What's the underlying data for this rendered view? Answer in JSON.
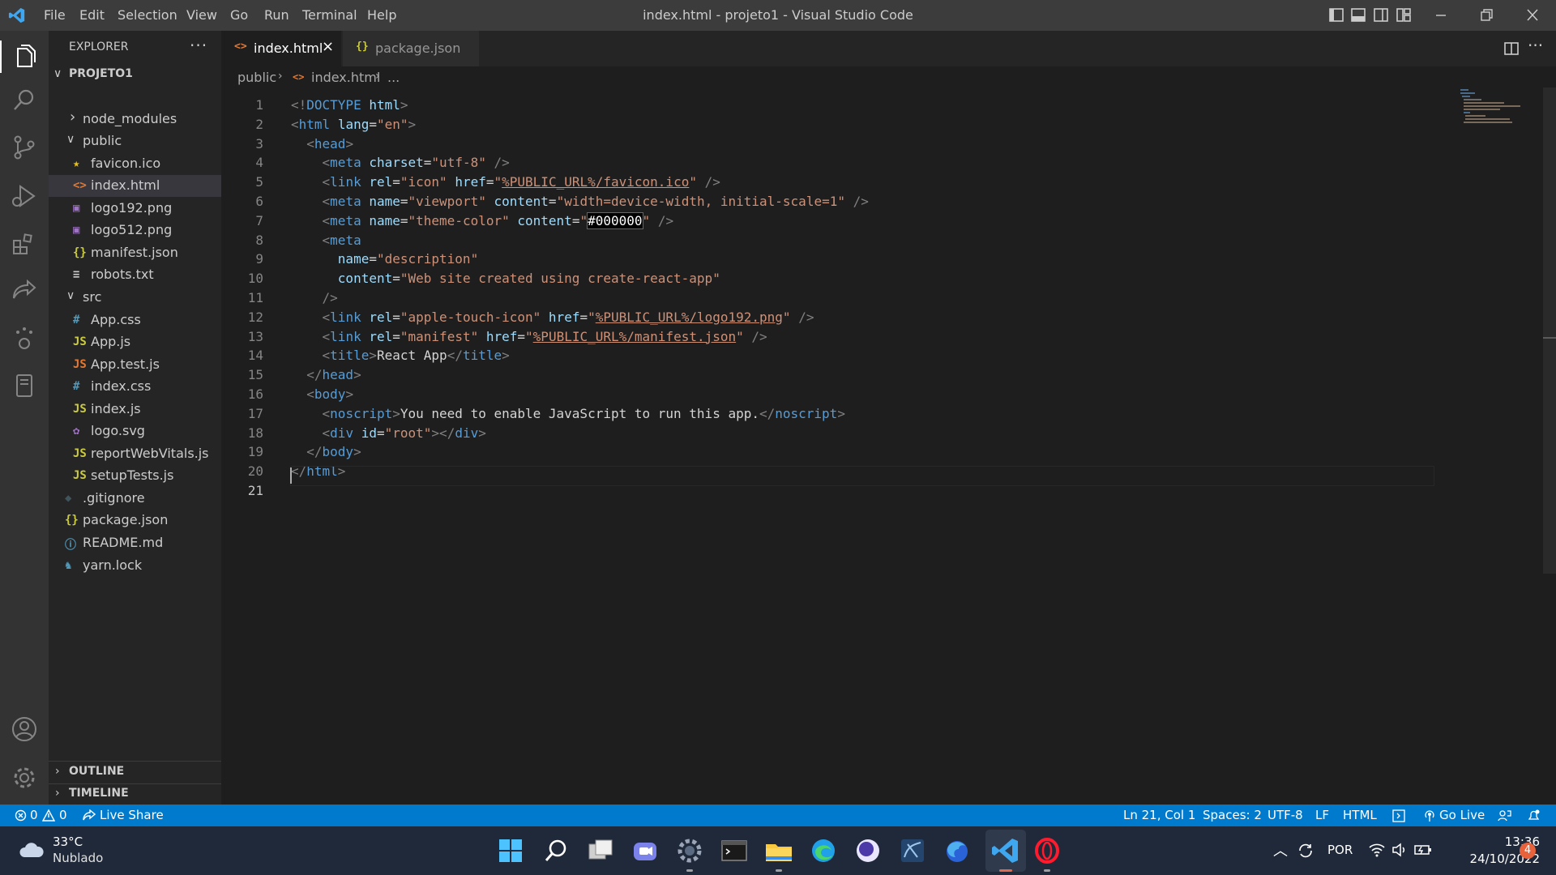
{
  "titlebar": {
    "menu": [
      "File",
      "Edit",
      "Selection",
      "View",
      "Go",
      "Run",
      "Terminal",
      "Help"
    ],
    "title": "index.html - projeto1 - Visual Studio Code"
  },
  "sidebar": {
    "header": "EXPLORER",
    "project": "PROJETO1",
    "tree": [
      {
        "name": "node_modules",
        "kind": "folder-closed",
        "icon": "chevron-right-icon"
      },
      {
        "name": "public",
        "kind": "folder-open",
        "icon": "chevron-down-icon"
      },
      {
        "name": "favicon.ico",
        "kind": "file",
        "icon": "star-icon",
        "glyph": "★",
        "color": "#e8c020"
      },
      {
        "name": "index.html",
        "kind": "file",
        "icon": "html-icon",
        "glyph": "<>",
        "color": "#e37933"
      },
      {
        "name": "logo192.png",
        "kind": "file",
        "icon": "image-icon",
        "glyph": "▣",
        "color": "#a074c4"
      },
      {
        "name": "logo512.png",
        "kind": "file",
        "icon": "image-icon",
        "glyph": "▣",
        "color": "#a074c4"
      },
      {
        "name": "manifest.json",
        "kind": "file",
        "icon": "json-icon",
        "glyph": "{}",
        "color": "#cbcb41"
      },
      {
        "name": "robots.txt",
        "kind": "file",
        "icon": "text-file-icon",
        "glyph": "≡",
        "color": "#cccccc"
      },
      {
        "name": "src",
        "kind": "folder-open",
        "icon": "chevron-down-icon"
      },
      {
        "name": "App.css",
        "kind": "file",
        "icon": "css-icon",
        "glyph": "#",
        "color": "#519aba"
      },
      {
        "name": "App.js",
        "kind": "file",
        "icon": "js-icon",
        "glyph": "JS",
        "color": "#cbcb41"
      },
      {
        "name": "App.test.js",
        "kind": "file",
        "icon": "js-test-icon",
        "glyph": "JS",
        "color": "#e37933"
      },
      {
        "name": "index.css",
        "kind": "file",
        "icon": "css-icon",
        "glyph": "#",
        "color": "#519aba"
      },
      {
        "name": "index.js",
        "kind": "file",
        "icon": "js-icon",
        "glyph": "JS",
        "color": "#cbcb41"
      },
      {
        "name": "logo.svg",
        "kind": "file",
        "icon": "svg-icon",
        "glyph": "✿",
        "color": "#a074c4"
      },
      {
        "name": "reportWebVitals.js",
        "kind": "file",
        "icon": "js-icon",
        "glyph": "JS",
        "color": "#cbcb41"
      },
      {
        "name": "setupTests.js",
        "kind": "file",
        "icon": "js-icon",
        "glyph": "JS",
        "color": "#cbcb41"
      },
      {
        "name": ".gitignore",
        "kind": "file",
        "icon": "git-icon",
        "glyph": "◆",
        "color": "#41535b"
      },
      {
        "name": "package.json",
        "kind": "file",
        "icon": "json-icon",
        "glyph": "{}",
        "color": "#cbcb41"
      },
      {
        "name": "README.md",
        "kind": "file",
        "icon": "info-icon",
        "glyph": "ⓘ",
        "color": "#519aba"
      },
      {
        "name": "yarn.lock",
        "kind": "file",
        "icon": "yarn-icon",
        "glyph": "♞",
        "color": "#519aba"
      }
    ],
    "outline": "OUTLINE",
    "timeline": "TIMELINE"
  },
  "tabs": [
    {
      "label": "index.html",
      "glyph": "<>",
      "color": "#e37933",
      "active": true
    },
    {
      "label": "package.json",
      "glyph": "{}",
      "color": "#cbcb41",
      "active": false
    }
  ],
  "breadcrumb": [
    "public",
    "index.html",
    "..."
  ],
  "code_lines": [
    [
      [
        "pn",
        "<!"
      ],
      [
        "tg",
        "DOCTYPE"
      ],
      [
        "tx",
        " "
      ],
      [
        "at",
        "html"
      ],
      [
        "pn",
        ">"
      ]
    ],
    [
      [
        "pn",
        "<"
      ],
      [
        "tg",
        "html"
      ],
      [
        "tx",
        " "
      ],
      [
        "at",
        "lang"
      ],
      [
        "tx",
        "="
      ],
      [
        "st",
        "\"en\""
      ],
      [
        "pn",
        ">"
      ]
    ],
    [
      [
        "tx",
        "  "
      ],
      [
        "pn",
        "<"
      ],
      [
        "tg",
        "head"
      ],
      [
        "pn",
        ">"
      ]
    ],
    [
      [
        "tx",
        "    "
      ],
      [
        "pn",
        "<"
      ],
      [
        "tg",
        "meta"
      ],
      [
        "tx",
        " "
      ],
      [
        "at",
        "charset"
      ],
      [
        "tx",
        "="
      ],
      [
        "st",
        "\"utf-8\""
      ],
      [
        "tx",
        " "
      ],
      [
        "pn",
        "/>"
      ]
    ],
    [
      [
        "tx",
        "    "
      ],
      [
        "pn",
        "<"
      ],
      [
        "tg",
        "link"
      ],
      [
        "tx",
        " "
      ],
      [
        "at",
        "rel"
      ],
      [
        "tx",
        "="
      ],
      [
        "st",
        "\"icon\""
      ],
      [
        "tx",
        " "
      ],
      [
        "at",
        "href"
      ],
      [
        "tx",
        "="
      ],
      [
        "st",
        "\""
      ],
      [
        "st ul",
        "%PUBLIC_URL%/favicon.ico"
      ],
      [
        "st",
        "\""
      ],
      [
        "tx",
        " "
      ],
      [
        "pn",
        "/>"
      ]
    ],
    [
      [
        "tx",
        "    "
      ],
      [
        "pn",
        "<"
      ],
      [
        "tg",
        "meta"
      ],
      [
        "tx",
        " "
      ],
      [
        "at",
        "name"
      ],
      [
        "tx",
        "="
      ],
      [
        "st",
        "\"viewport\""
      ],
      [
        "tx",
        " "
      ],
      [
        "at",
        "content"
      ],
      [
        "tx",
        "="
      ],
      [
        "st",
        "\"width=device-width, initial-scale=1\""
      ],
      [
        "tx",
        " "
      ],
      [
        "pn",
        "/>"
      ]
    ],
    [
      [
        "tx",
        "    "
      ],
      [
        "pn",
        "<"
      ],
      [
        "tg",
        "meta"
      ],
      [
        "tx",
        " "
      ],
      [
        "at",
        "name"
      ],
      [
        "tx",
        "="
      ],
      [
        "st",
        "\"theme-color\""
      ],
      [
        "tx",
        " "
      ],
      [
        "at",
        "content"
      ],
      [
        "tx",
        "="
      ],
      [
        "st",
        "\""
      ],
      [
        "sw",
        "#000000"
      ],
      [
        "st",
        "\""
      ],
      [
        "tx",
        " "
      ],
      [
        "pn",
        "/>"
      ]
    ],
    [
      [
        "tx",
        "    "
      ],
      [
        "pn",
        "<"
      ],
      [
        "tg",
        "meta"
      ]
    ],
    [
      [
        "tx",
        "      "
      ],
      [
        "at",
        "name"
      ],
      [
        "tx",
        "="
      ],
      [
        "st",
        "\"description\""
      ]
    ],
    [
      [
        "tx",
        "      "
      ],
      [
        "at",
        "content"
      ],
      [
        "tx",
        "="
      ],
      [
        "st",
        "\"Web site created using create-react-app\""
      ]
    ],
    [
      [
        "tx",
        "    "
      ],
      [
        "pn",
        "/>"
      ]
    ],
    [
      [
        "tx",
        "    "
      ],
      [
        "pn",
        "<"
      ],
      [
        "tg",
        "link"
      ],
      [
        "tx",
        " "
      ],
      [
        "at",
        "rel"
      ],
      [
        "tx",
        "="
      ],
      [
        "st",
        "\"apple-touch-icon\""
      ],
      [
        "tx",
        " "
      ],
      [
        "at",
        "href"
      ],
      [
        "tx",
        "="
      ],
      [
        "st",
        "\""
      ],
      [
        "st ul",
        "%PUBLIC_URL%/logo192.png"
      ],
      [
        "st",
        "\""
      ],
      [
        "tx",
        " "
      ],
      [
        "pn",
        "/>"
      ]
    ],
    [
      [
        "tx",
        "    "
      ],
      [
        "pn",
        "<"
      ],
      [
        "tg",
        "link"
      ],
      [
        "tx",
        " "
      ],
      [
        "at",
        "rel"
      ],
      [
        "tx",
        "="
      ],
      [
        "st",
        "\"manifest\""
      ],
      [
        "tx",
        " "
      ],
      [
        "at",
        "href"
      ],
      [
        "tx",
        "="
      ],
      [
        "st",
        "\""
      ],
      [
        "st ul",
        "%PUBLIC_URL%/manifest.json"
      ],
      [
        "st",
        "\""
      ],
      [
        "tx",
        " "
      ],
      [
        "pn",
        "/>"
      ]
    ],
    [
      [
        "tx",
        "    "
      ],
      [
        "pn",
        "<"
      ],
      [
        "tg",
        "title"
      ],
      [
        "pn",
        ">"
      ],
      [
        "tx",
        "React App"
      ],
      [
        "pn",
        "</"
      ],
      [
        "tg",
        "title"
      ],
      [
        "pn",
        ">"
      ]
    ],
    [
      [
        "tx",
        "  "
      ],
      [
        "pn",
        "</"
      ],
      [
        "tg",
        "head"
      ],
      [
        "pn",
        ">"
      ]
    ],
    [
      [
        "tx",
        "  "
      ],
      [
        "pn",
        "<"
      ],
      [
        "tg",
        "body"
      ],
      [
        "pn",
        ">"
      ]
    ],
    [
      [
        "tx",
        "    "
      ],
      [
        "pn",
        "<"
      ],
      [
        "tg",
        "noscript"
      ],
      [
        "pn",
        ">"
      ],
      [
        "tx",
        "You need to enable JavaScript to run this app."
      ],
      [
        "pn",
        "</"
      ],
      [
        "tg",
        "noscript"
      ],
      [
        "pn",
        ">"
      ]
    ],
    [
      [
        "tx",
        "    "
      ],
      [
        "pn",
        "<"
      ],
      [
        "tg",
        "div"
      ],
      [
        "tx",
        " "
      ],
      [
        "at",
        "id"
      ],
      [
        "tx",
        "="
      ],
      [
        "st",
        "\"root\""
      ],
      [
        "pn",
        "></"
      ],
      [
        "tg",
        "div"
      ],
      [
        "pn",
        ">"
      ]
    ],
    [
      [
        "tx",
        "  "
      ],
      [
        "pn",
        "</"
      ],
      [
        "tg",
        "body"
      ],
      [
        "pn",
        ">"
      ]
    ],
    [
      [
        "pn",
        "</"
      ],
      [
        "tg",
        "html"
      ],
      [
        "pn",
        ">"
      ]
    ],
    []
  ],
  "status": {
    "errors": "0",
    "warnings": "0",
    "live_share": "Live Share",
    "position": "Ln 21, Col 1",
    "spaces": "Spaces: 2",
    "encoding": "UTF-8",
    "eol": "LF",
    "language": "HTML",
    "go_live": "Go Live"
  },
  "taskbar": {
    "temperature": "33°C",
    "weather": "Nublado",
    "language": "POR",
    "time": "13:36",
    "date": "24/10/2022",
    "notifications": "4"
  },
  "colors": {
    "accent": "#007acc",
    "titlebar": "#3c3c3c",
    "activitybar": "#333333",
    "sidebar": "#252526",
    "editor": "#1e1e1e"
  }
}
